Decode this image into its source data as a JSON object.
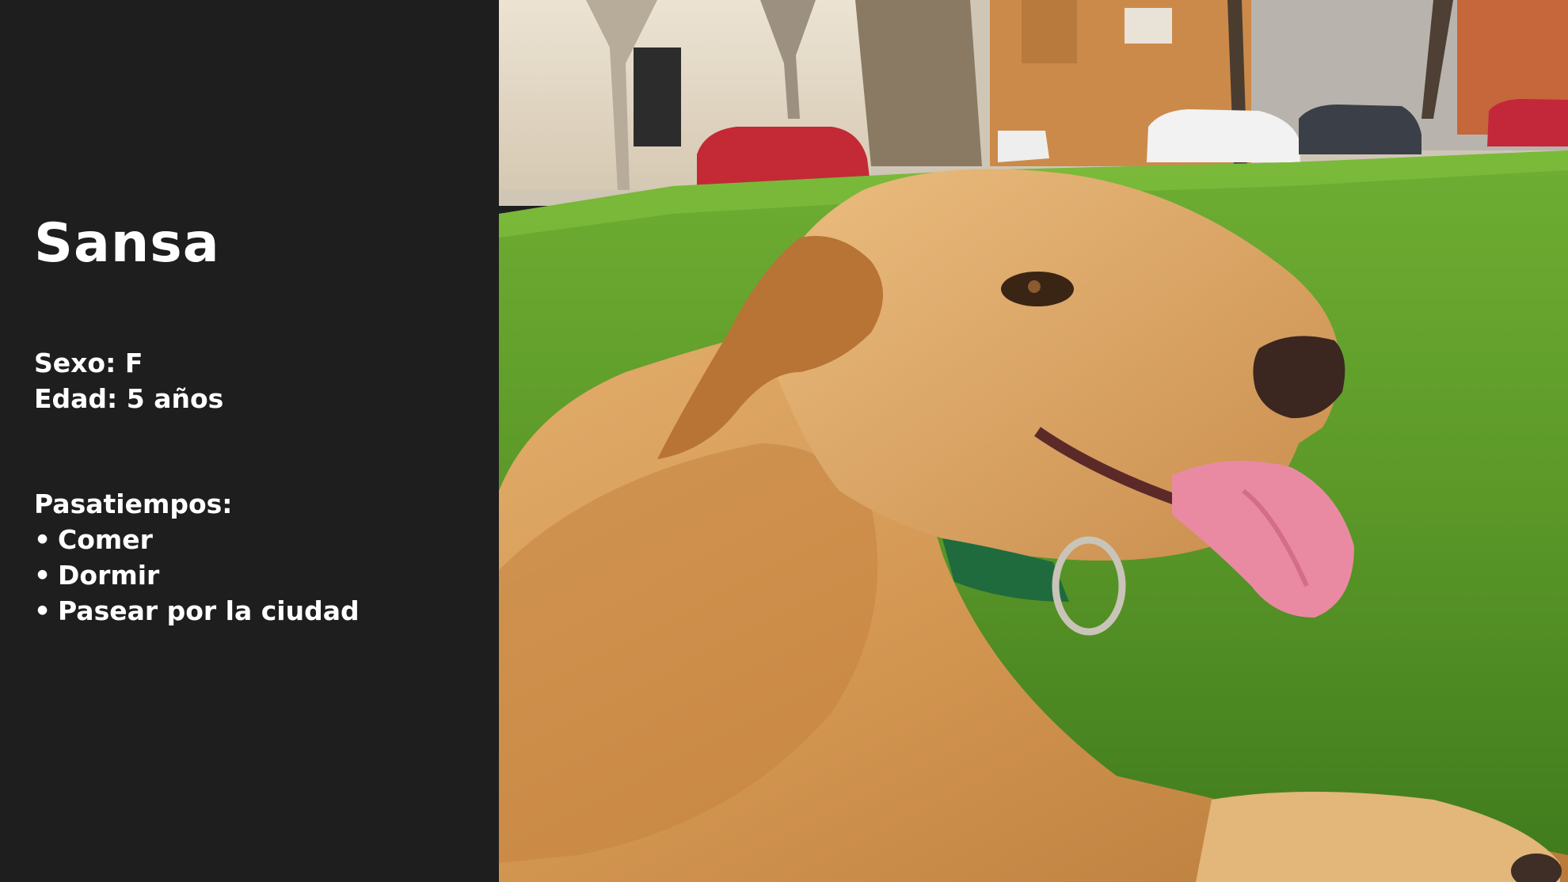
{
  "slide": {
    "name": "Sansa",
    "sex_label": "Sexo:",
    "sex_value": "F",
    "age_label": "Edad:",
    "age_value": "5 años",
    "hobbies_title": "Pasatiempos:",
    "hobbies": [
      "Comer",
      "Dormir",
      "Pasear por la ciudad"
    ],
    "bullet": "•"
  },
  "photo": {
    "subject": "golden dog lying on grass in a park",
    "colors": {
      "panel_bg": "#1e1e1e",
      "grass": "#5d9a2a",
      "fur": "#d39a58",
      "tongue": "#e98aa2"
    }
  }
}
